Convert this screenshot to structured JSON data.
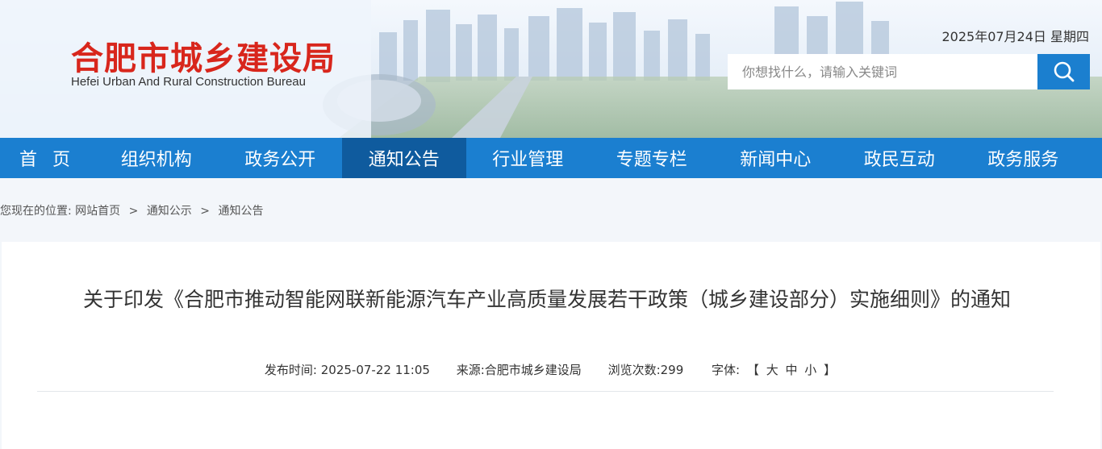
{
  "header": {
    "site_title": "合肥市城乡建设局",
    "site_subtitle": "Hefei Urban And Rural Construction Bureau",
    "date": "2025年07月24日 星期四",
    "search_placeholder": "你想找什么，请输入关键词"
  },
  "nav": {
    "items": [
      {
        "label": "首 页"
      },
      {
        "label": "组织机构"
      },
      {
        "label": "政务公开"
      },
      {
        "label": "通知公告"
      },
      {
        "label": "行业管理"
      },
      {
        "label": "专题专栏"
      },
      {
        "label": "新闻中心"
      },
      {
        "label": "政民互动"
      },
      {
        "label": "政务服务"
      }
    ],
    "active_index": 3
  },
  "breadcrumb": {
    "prefix": "您现在的位置:",
    "items": [
      "网站首页",
      "通知公示",
      "通知公告"
    ],
    "separator": ">"
  },
  "article": {
    "title": "关于印发《合肥市推动智能网联新能源汽车产业高质量发展若干政策（城乡建设部分）实施细则》的通知",
    "publish_label": "发布时间:",
    "publish_time": "2025-07-22 11:05",
    "source_label": "来源:",
    "source": "合肥市城乡建设局",
    "views_label": "浏览次数:",
    "views": "299",
    "font_label": "字体:",
    "font_open": "【",
    "font_large": "大",
    "font_medium": "中",
    "font_small": "小",
    "font_close": "】"
  },
  "colors": {
    "brand_red": "#d8261c",
    "nav_blue": "#1b7fd0",
    "nav_active": "#0f5b9e",
    "search_button": "#1b7fcf"
  },
  "icons": {
    "search": "search-icon"
  }
}
